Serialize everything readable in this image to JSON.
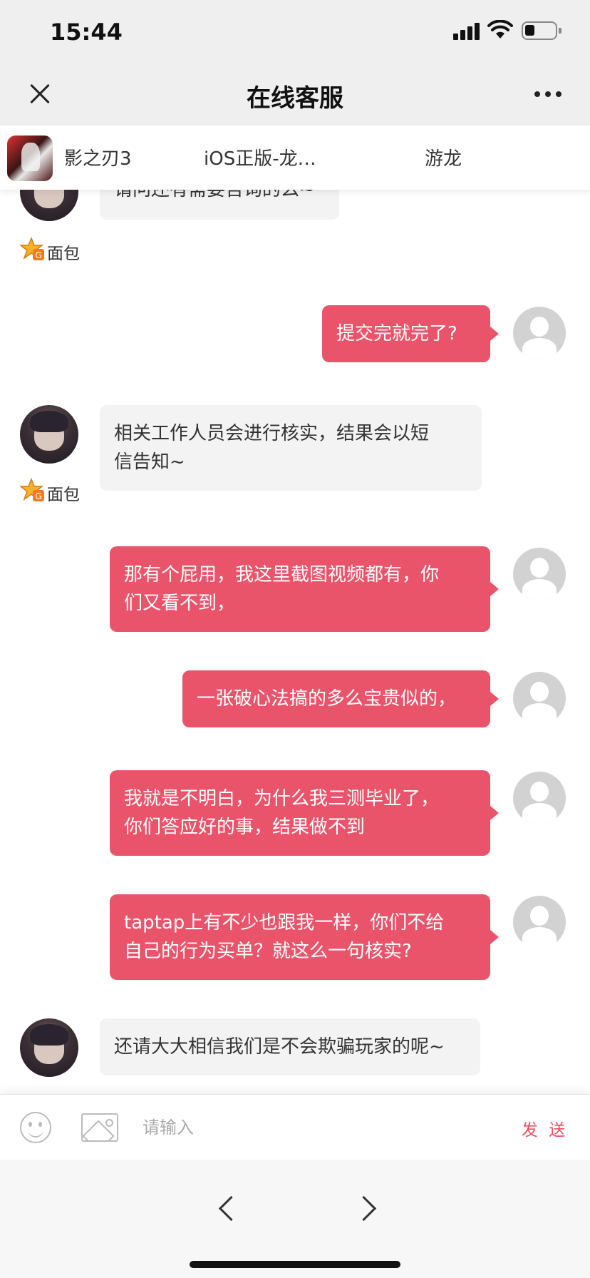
{
  "status_bar": {
    "time": "15:44"
  },
  "nav": {
    "title": "在线客服"
  },
  "game_bar": {
    "game_name": "影之刃3",
    "server": "iOS正版-龙…",
    "role": "游龙"
  },
  "badge": {
    "label": "面包"
  },
  "messages": [
    {
      "from": "agent",
      "text": "请问还有需要咨询的么~"
    },
    {
      "from": "user",
      "text": "提交完就完了?"
    },
    {
      "from": "agent",
      "line1": "相关工作人员会进行核实，结果会以短",
      "line2": "信告知~"
    },
    {
      "from": "user",
      "line1": "那有个屁用，我这里截图视频都有，你",
      "line2": "们又看不到，"
    },
    {
      "from": "user",
      "text": "一张破心法搞的多么宝贵似的，"
    },
    {
      "from": "user",
      "line1": "我就是不明白，为什么我三测毕业了，",
      "line2": "你们答应好的事，结果做不到"
    },
    {
      "from": "user",
      "line1": "taptap上有不少也跟我一样，你们不给",
      "line2": "自己的行为买单？就这么一句核实?"
    },
    {
      "from": "agent",
      "text": "还请大大相信我们是不会欺骗玩家的呢~"
    }
  ],
  "input": {
    "placeholder": "请输入",
    "send_label": "发 送"
  },
  "colors": {
    "user_bubble": "#ea546b",
    "agent_bubble": "#f3f3f3",
    "send": "#e94e63"
  },
  "icons": [
    "close-icon",
    "more-icon",
    "emoji-icon",
    "image-icon",
    "back-icon",
    "forward-icon",
    "bread-badge-icon"
  ]
}
